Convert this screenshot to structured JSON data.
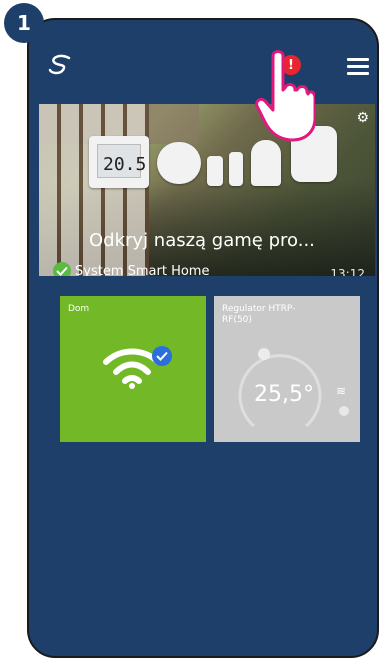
{
  "step": "1",
  "topbar": {
    "alert_symbol": "!",
    "logo_icon": "salus-logo-icon",
    "menu_icon": "hamburger-menu-icon"
  },
  "banner": {
    "title": "Odkryj naszą gamę pro...",
    "subtitle": "System Smart Home",
    "time": "13:12",
    "thermostat_reading": "20.5",
    "settings_icon": "gear-icon"
  },
  "tiles": [
    {
      "label": "Dom",
      "status": "connected"
    },
    {
      "label": "Regulator HTRP-\nRF(50)",
      "temperature": "25,5°"
    }
  ],
  "colors": {
    "background": "#1e3f6a",
    "tile_green": "#72b827",
    "tile_grey": "#c9c9c9",
    "alert": "#e8262f"
  }
}
